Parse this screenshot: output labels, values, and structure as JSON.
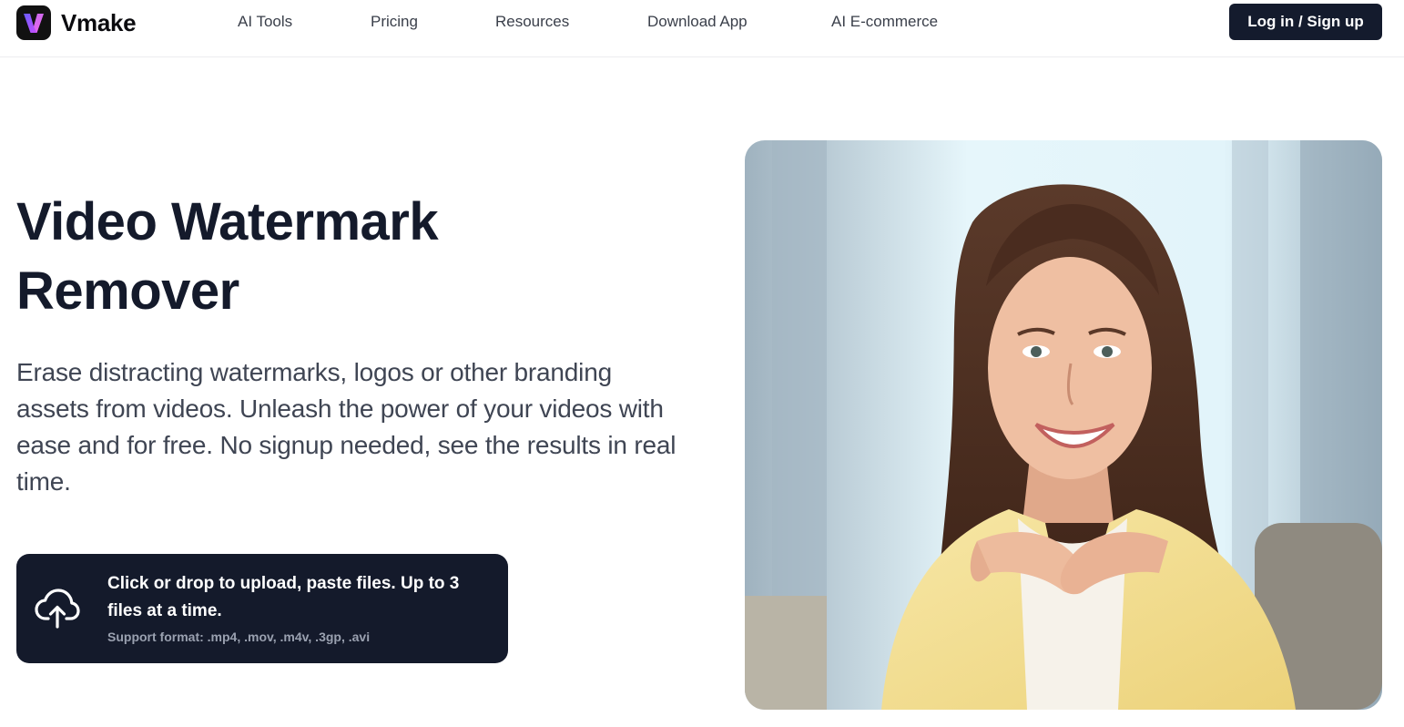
{
  "brand": {
    "name": "Vmake",
    "logo_icon": "vmake-v-logo-icon",
    "accent_gradient": [
      "#6a5cff",
      "#d84dff"
    ]
  },
  "nav": {
    "items": [
      {
        "label": "AI Tools"
      },
      {
        "label": "Pricing"
      },
      {
        "label": "Resources"
      },
      {
        "label": "Download App"
      },
      {
        "label": "AI E-commerce"
      }
    ],
    "login_label": "Log in / Sign up"
  },
  "hero": {
    "title_line1": "Video Watermark",
    "title_line2": "Remover",
    "description": "Erase distracting watermarks, logos or other branding assets from videos. Unleash the power of your videos with ease and for free. No signup needed, see the results in real time."
  },
  "upload": {
    "icon": "cloud-upload-icon",
    "title": "Click or drop to upload, paste files. Up to 3 files at a time.",
    "support": "Support format: .mp4, .mov, .m4v, .3gp, .avi"
  },
  "colors": {
    "dark_button": "#141b2d",
    "title_text": "#141a2b",
    "body_text": "#3f4553",
    "nav_text": "#3a3f4a"
  }
}
